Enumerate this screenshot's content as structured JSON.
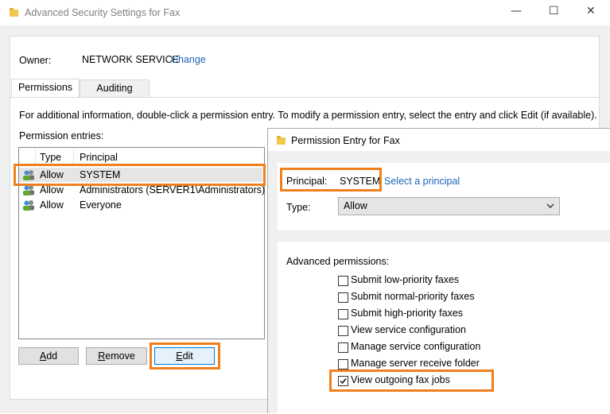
{
  "main_window": {
    "title": "Advanced Security Settings for Fax",
    "controls": {
      "minimize": "—",
      "maximize": "☐",
      "close": "✕"
    },
    "owner_label": "Owner:",
    "owner_value": "NETWORK SERVICE",
    "owner_change_link": "Change",
    "tabs": [
      {
        "label": "Permissions",
        "active": true
      },
      {
        "label": "Auditing",
        "active": false
      }
    ],
    "info_text": "For additional information, double-click a permission entry. To modify a permission entry, select the entry and click Edit (if available).",
    "entries_label": "Permission entries:",
    "columns": [
      "Type",
      "Principal"
    ],
    "entries": [
      {
        "type": "Allow",
        "principal": "SYSTEM"
      },
      {
        "type": "Allow",
        "principal": "Administrators (SERVER1\\Administrators)"
      },
      {
        "type": "Allow",
        "principal": "Everyone"
      }
    ],
    "buttons": {
      "add": "Add",
      "remove": "Remove",
      "edit": "Edit"
    }
  },
  "entry_dialog": {
    "title": "Permission Entry for Fax",
    "principal_label": "Principal:",
    "principal_value": "SYSTEM",
    "select_principal_link": "Select a principal",
    "type_label": "Type:",
    "type_value": "Allow",
    "advanced_label": "Advanced permissions:",
    "permissions": [
      {
        "label": "Submit low-priority faxes",
        "checked": false
      },
      {
        "label": "Submit normal-priority faxes",
        "checked": false
      },
      {
        "label": "Submit high-priority faxes",
        "checked": false
      },
      {
        "label": "View service configuration",
        "checked": false
      },
      {
        "label": "Manage service configuration",
        "checked": false
      },
      {
        "label": "Manage server receive folder",
        "checked": false
      },
      {
        "label": "View outgoing fax jobs",
        "checked": true
      }
    ]
  },
  "colors": {
    "highlight": "#f07f1d",
    "link": "#1a66b8"
  },
  "icons": {
    "folder": "folder-icon",
    "user": "users-icon",
    "dropdown": "chevron-down-icon",
    "check": "checkmark-icon"
  }
}
